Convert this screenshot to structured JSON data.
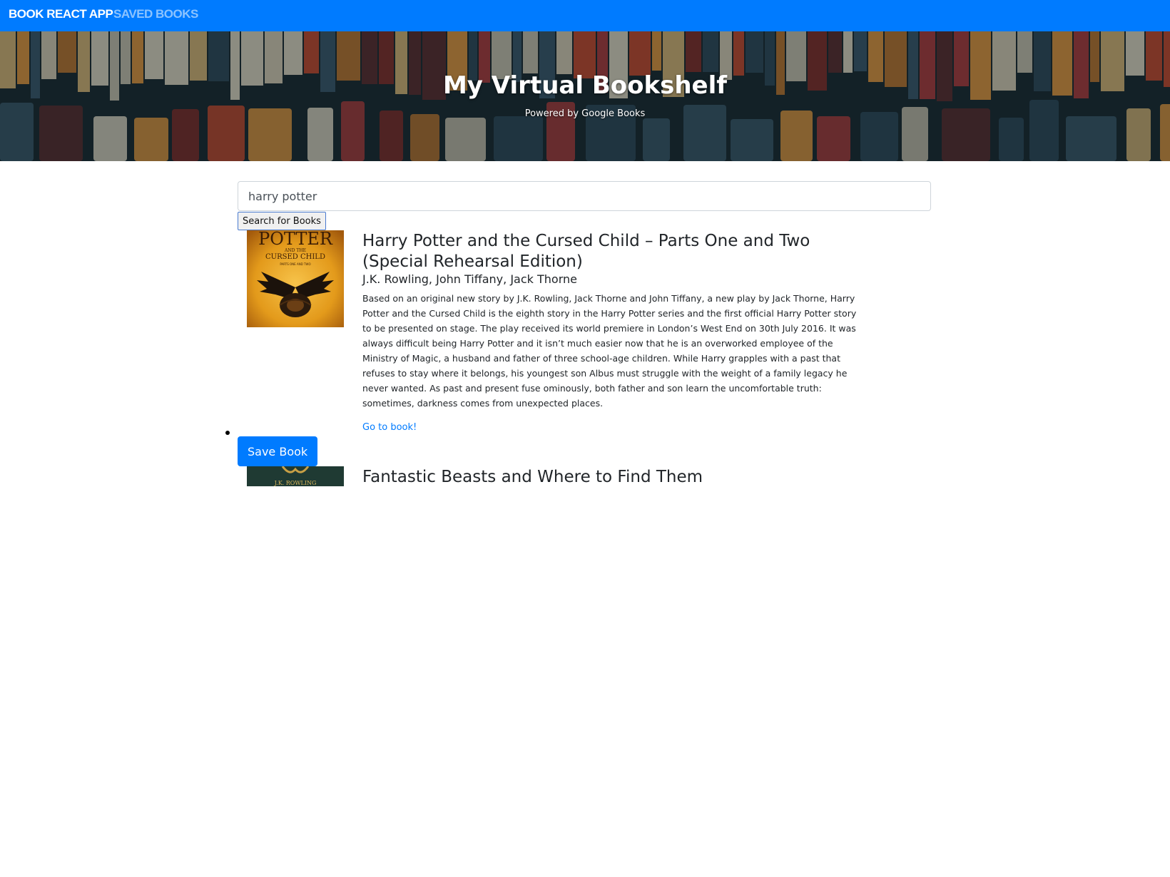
{
  "navbar": {
    "brand": "BOOK REACT APP",
    "saved_link": "SAVED BOOKS"
  },
  "hero": {
    "title": "My Virtual Bookshelf",
    "subtitle": "Powered by Google Books"
  },
  "search": {
    "value": "harry potter",
    "button_label": "Search for Books"
  },
  "results": [
    {
      "title": "Harry Potter and the Cursed Child – Parts One and Two (Special Rehearsal Edition)",
      "authors": "J.K. Rowling, John Tiffany, Jack Thorne",
      "description": "Based on an original new story by J.K. Rowling, Jack Thorne and John Tiffany, a new play by Jack Thorne, Harry Potter and the Cursed Child is the eighth story in the Harry Potter series and the first official Harry Potter story to be presented on stage. The play received its world premiere in London’s West End on 30th July 2016. It was always difficult being Harry Potter and it isn’t much easier now that he is an overworked employee of the Ministry of Magic, a husband and father of three school-age children. While Harry grapples with a past that refuses to stay where it belongs, his youngest son Albus must struggle with the weight of a family legacy he never wanted. As past and present fuse ominously, both father and son learn the uncomfortable truth: sometimes, darkness comes from unexpected places.",
      "link_label": "Go to book!",
      "save_label": "Save Book",
      "cover": {
        "line1": "POTTER",
        "line2": "AND THE",
        "line3": "CURSED CHILD",
        "line4": "PARTS ONE AND TWO"
      }
    },
    {
      "title": "Fantastic Beasts and Where to Find Them",
      "cover": {
        "line1": "J.K. ROWLING"
      }
    }
  ],
  "colors": {
    "primary": "#007bff",
    "navbar_bg": "#007bff"
  }
}
